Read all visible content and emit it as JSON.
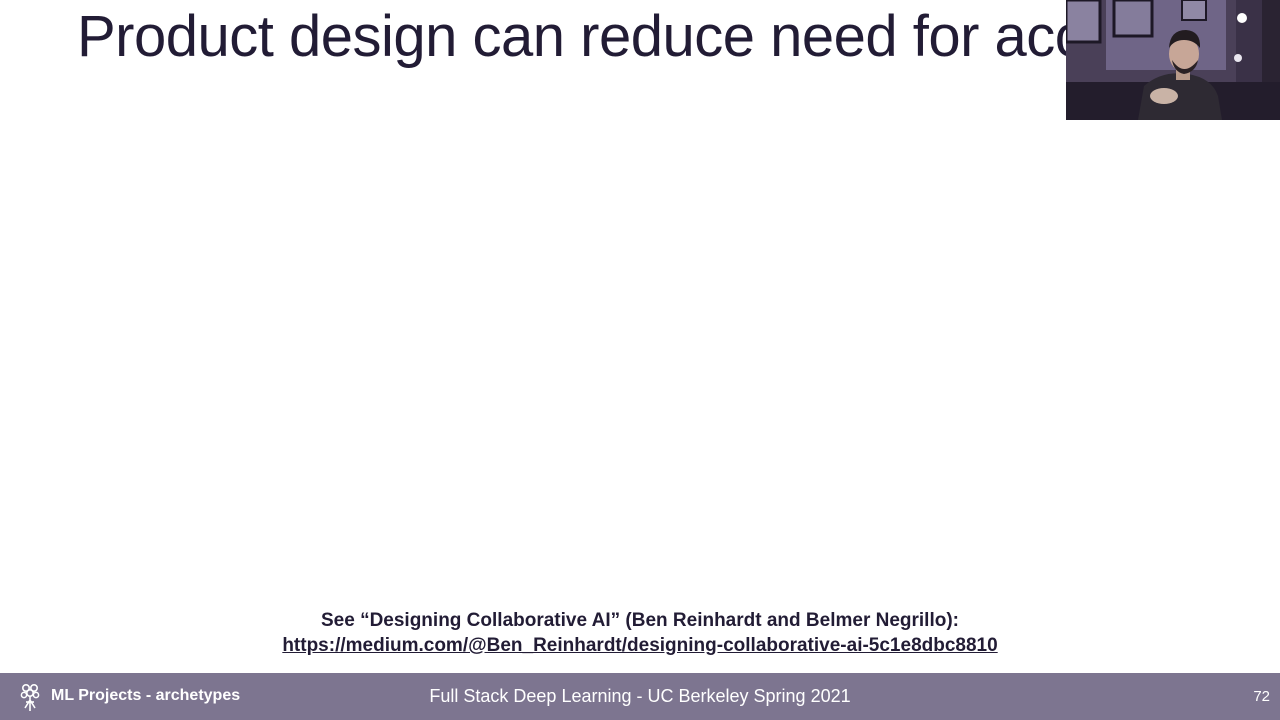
{
  "slide": {
    "title": "Product design can reduce need for acc",
    "citation_line": "See “Designing Collaborative AI” (Ben Reinhardt and Belmer Negrillo):",
    "citation_url": "https://medium.com/@Ben_Reinhardt/designing-collaborative-ai-5c1e8dbc8810"
  },
  "footer": {
    "section": "ML Projects - archetypes",
    "course": "Full Stack Deep Learning - UC Berkeley Spring 2021",
    "page_number": "72",
    "logo_icon": "flower-bouquet-icon"
  },
  "webcam": {
    "icon": "presenter-video-icon"
  },
  "colors": {
    "title_text": "#221c35",
    "footer_bg": "#7d7590",
    "footer_text": "#ffffff"
  }
}
